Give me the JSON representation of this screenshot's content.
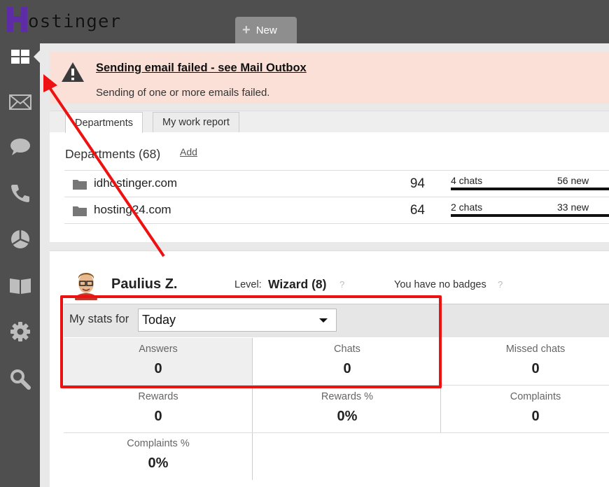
{
  "app": {
    "logo_text": "ostinger",
    "logo_letter": "H"
  },
  "topbar": {
    "new_tab_label": "New"
  },
  "sidebar": {
    "items": [
      {
        "icon": "dashboard-icon",
        "active": true
      },
      {
        "icon": "mail-icon"
      },
      {
        "icon": "chat-icon"
      },
      {
        "icon": "phone-icon"
      },
      {
        "icon": "reports-pie-icon"
      },
      {
        "icon": "knowledge-book-icon"
      },
      {
        "icon": "settings-gear-icon"
      },
      {
        "icon": "search-icon"
      }
    ]
  },
  "alert": {
    "title": "Sending email failed - see Mail Outbox",
    "message": "Sending of one or more emails failed."
  },
  "dept_panel": {
    "tabs": [
      {
        "label": "Departments"
      },
      {
        "label": "My work report"
      }
    ],
    "title": "Departments (68)",
    "add_label": "Add",
    "rows": [
      {
        "name": "idhostinger.com",
        "count": "94",
        "chats": "4 chats",
        "new": "56 new"
      },
      {
        "name": "hosting24.com",
        "count": "64",
        "chats": "2 chats",
        "new": "33 new"
      }
    ]
  },
  "profile": {
    "name": "Paulius Z.",
    "level_label": "Level:",
    "level_value": "Wizard (8)",
    "badges_text": "You have no badges",
    "help": "?"
  },
  "stats": {
    "label": "My stats for",
    "period": "Today",
    "cells": [
      {
        "label": "Answers",
        "value": "0"
      },
      {
        "label": "Chats",
        "value": "0"
      },
      {
        "label": "Missed chats",
        "value": "0"
      },
      {
        "label": "Rewards",
        "value": "0"
      },
      {
        "label": "Rewards %",
        "value": "0%"
      },
      {
        "label": "Complaints",
        "value": "0"
      },
      {
        "label": "Complaints %",
        "value": "0%"
      }
    ]
  },
  "colors": {
    "brand": "#5e2ca5",
    "annotation": "#ee1111",
    "alert_bg": "#fbe0d8",
    "sidebar_bg": "#4f4f4f"
  }
}
